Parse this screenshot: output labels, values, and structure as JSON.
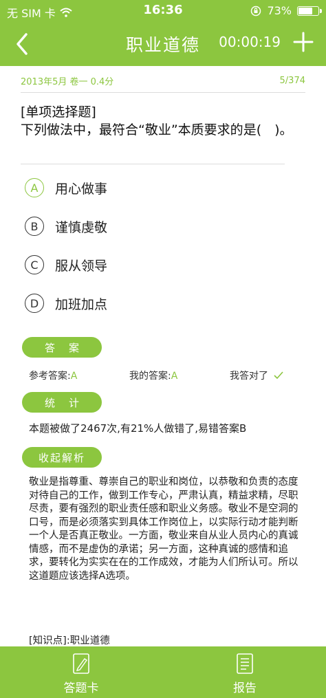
{
  "status_bar": {
    "carrier": "无 SIM 卡",
    "time": "16:36",
    "battery_text": "73%",
    "battery_level": 0.73
  },
  "nav": {
    "title": "职业道德",
    "timer": "00:00:19"
  },
  "meta": {
    "info": "2013年5月 卷一 0.4分",
    "progress": "5/374"
  },
  "question": {
    "type": "[单项选择题]",
    "text": "下列做法中，最符合“敬业”本质要求的是(　)。"
  },
  "options": [
    {
      "letter": "A",
      "text": "用心做事",
      "correct": true
    },
    {
      "letter": "B",
      "text": "谨慎虔敬",
      "correct": false
    },
    {
      "letter": "C",
      "text": "服从领导",
      "correct": false
    },
    {
      "letter": "D",
      "text": "加班加点",
      "correct": false
    }
  ],
  "answer_section": {
    "label": "答案",
    "reference_label": "参考答案:",
    "reference_value": "A",
    "mine_label": "我的答案:",
    "mine_value": "A",
    "result": "我答对了"
  },
  "stats_section": {
    "label": "统计",
    "text": "本题被做了2467次,有21%人做错了,易错答案B"
  },
  "analysis_section": {
    "label": "收起解析",
    "text": "敬业是指尊重、尊崇自己的职业和岗位，以恭敬和负责的态度对待自己的工作，做到工作专心，严肃认真，精益求精，尽职尽责，要有强烈的职业责任感和职业义务感。敬业不是空洞的口号，而是必须落实到具体工作岗位上，以实际行动才能判断一个人是否真正敬业。一方面，敬业来自从业人员内心的真诚情感，而不是虚伪的承诺；另一方面，这种真诚的感情和追求，要转化为实实在在的工作成效，才能为人们所认可。所以这道题应该选择A选项。",
    "knowledge_point": "[知识点]:职业道德"
  },
  "bottom_bar": {
    "answer_card": "答题卡",
    "report": "报告"
  },
  "colors": {
    "accent": "#8cc63f"
  }
}
